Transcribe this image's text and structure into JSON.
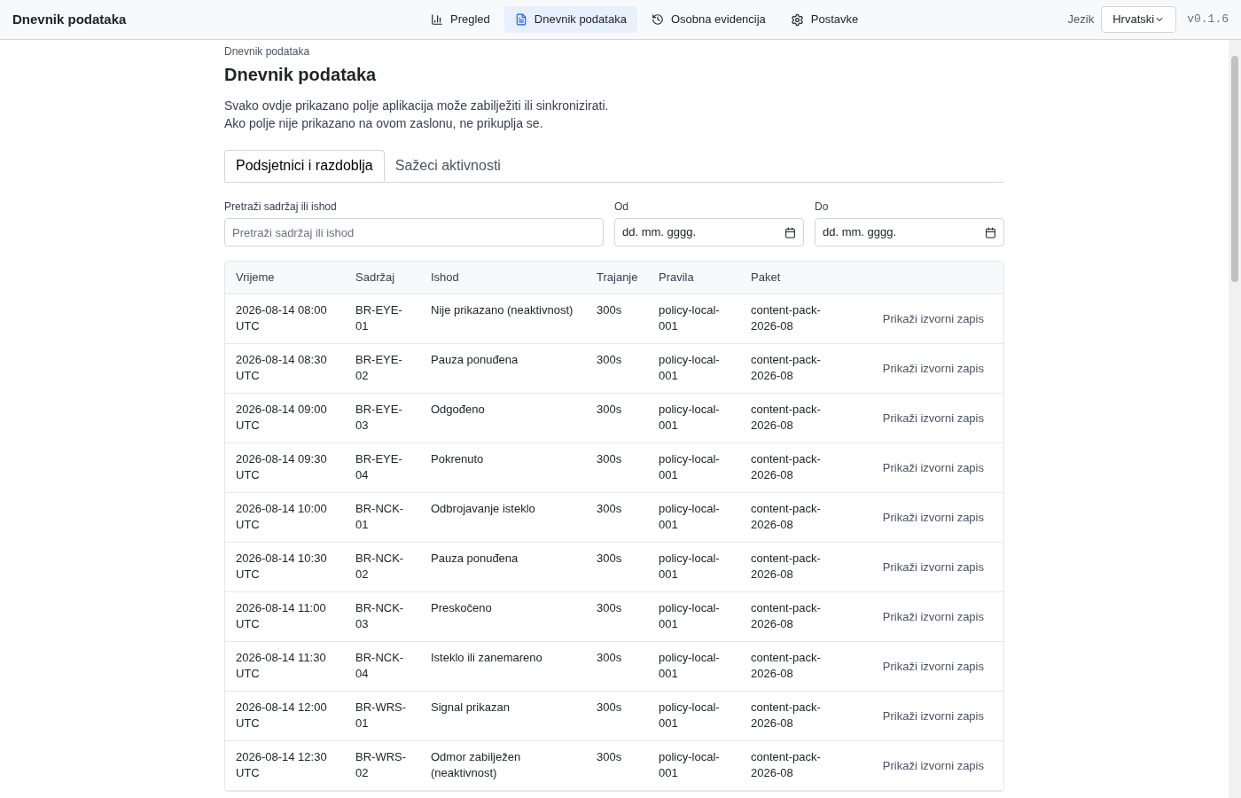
{
  "app_title": "Dnevnik podataka",
  "nav": [
    {
      "label": "Pregled",
      "selected": false
    },
    {
      "label": "Dnevnik podataka",
      "selected": true
    },
    {
      "label": "Osobna evidencija",
      "selected": false
    },
    {
      "label": "Postavke",
      "selected": false
    }
  ],
  "language": {
    "label": "Jezik",
    "value": "Hrvatski"
  },
  "version": "v0.1.6",
  "breadcrumb": "Dnevnik podataka",
  "heading": "Dnevnik podataka",
  "intro": [
    "Svako ovdje prikazano polje aplikacija može zabilježiti ili sinkronizirati.",
    "Ako polje nije prikazano na ovom zaslonu, ne prikuplja se."
  ],
  "tabs": [
    {
      "label": "Podsjetnici i razdoblja",
      "selected": true
    },
    {
      "label": "Sažeci aktivnosti",
      "selected": false
    }
  ],
  "filters": {
    "search": {
      "label": "Pretraži sadržaj ili ishod",
      "placeholder": "Pretraži sadržaj ili ishod"
    },
    "from": {
      "label": "Od",
      "value": "dd. mm. gggg."
    },
    "to": {
      "label": "Do",
      "value": "dd. mm. gggg."
    }
  },
  "table": {
    "columns": [
      "Vrijeme",
      "Sadržaj",
      "Ishod",
      "Trajanje",
      "Pravila",
      "Paket"
    ],
    "rows": [
      {
        "time": "2026-08-14 08:00 UTC",
        "content": "BR-EYE-01",
        "outcome": "Nije prikazano (neaktivnost)",
        "duration": "300s",
        "policy": "policy-local-001",
        "pack": "content-pack-2026-08",
        "action": "Prikaži izvorni zapis"
      },
      {
        "time": "2026-08-14 08:30 UTC",
        "content": "BR-EYE-02",
        "outcome": "Pauza ponuđena",
        "duration": "300s",
        "policy": "policy-local-001",
        "pack": "content-pack-2026-08",
        "action": "Prikaži izvorni zapis"
      },
      {
        "time": "2026-08-14 09:00 UTC",
        "content": "BR-EYE-03",
        "outcome": "Odgođeno",
        "duration": "300s",
        "policy": "policy-local-001",
        "pack": "content-pack-2026-08",
        "action": "Prikaži izvorni zapis"
      },
      {
        "time": "2026-08-14 09:30 UTC",
        "content": "BR-EYE-04",
        "outcome": "Pokrenuto",
        "duration": "300s",
        "policy": "policy-local-001",
        "pack": "content-pack-2026-08",
        "action": "Prikaži izvorni zapis"
      },
      {
        "time": "2026-08-14 10:00 UTC",
        "content": "BR-NCK-01",
        "outcome": "Odbrojavanje isteklo",
        "duration": "300s",
        "policy": "policy-local-001",
        "pack": "content-pack-2026-08",
        "action": "Prikaži izvorni zapis"
      },
      {
        "time": "2026-08-14 10:30 UTC",
        "content": "BR-NCK-02",
        "outcome": "Pauza ponuđena",
        "duration": "300s",
        "policy": "policy-local-001",
        "pack": "content-pack-2026-08",
        "action": "Prikaži izvorni zapis"
      },
      {
        "time": "2026-08-14 11:00 UTC",
        "content": "BR-NCK-03",
        "outcome": "Preskočeno",
        "duration": "300s",
        "policy": "policy-local-001",
        "pack": "content-pack-2026-08",
        "action": "Prikaži izvorni zapis"
      },
      {
        "time": "2026-08-14 11:30 UTC",
        "content": "BR-NCK-04",
        "outcome": "Isteklo ili zanemareno",
        "duration": "300s",
        "policy": "policy-local-001",
        "pack": "content-pack-2026-08",
        "action": "Prikaži izvorni zapis"
      },
      {
        "time": "2026-08-14 12:00 UTC",
        "content": "BR-WRS-01",
        "outcome": "Signal prikazan",
        "duration": "300s",
        "policy": "policy-local-001",
        "pack": "content-pack-2026-08",
        "action": "Prikaži izvorni zapis"
      },
      {
        "time": "2026-08-14 12:30 UTC",
        "content": "BR-WRS-02",
        "outcome": "Odmor zabilježen (neaktivnost)",
        "duration": "300s",
        "policy": "policy-local-001",
        "pack": "content-pack-2026-08",
        "action": "Prikaži izvorni zapis"
      }
    ]
  }
}
